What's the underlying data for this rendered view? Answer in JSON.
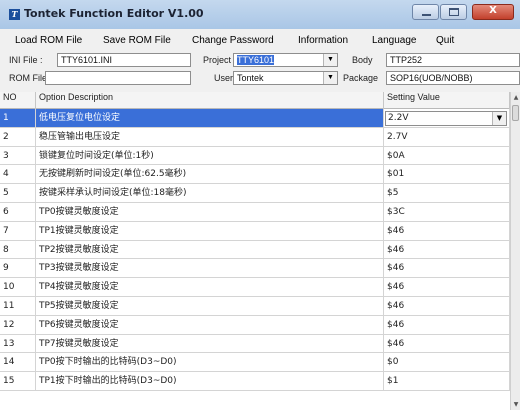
{
  "window": {
    "title": "Tontek Function Editor V1.00",
    "app_icon_glyph": "T",
    "close_glyph": "X"
  },
  "menu": [
    {
      "label": "Load ROM File"
    },
    {
      "label": "Save ROM File"
    },
    {
      "label": "Change Password"
    },
    {
      "label": "Information"
    },
    {
      "label": "Language"
    },
    {
      "label": "Quit"
    }
  ],
  "form": {
    "ini_file_label": "INI File :",
    "ini_file_value": "TTY6101.INI",
    "project_label": "Project",
    "project_value": "TTY6101",
    "body_label": "Body",
    "body_value": "TTP252",
    "rom_file_label": "ROM File",
    "rom_file_value": "",
    "user_label": "User",
    "user_value": "Tontek",
    "package_label": "Package",
    "package_value": "SOP16(UOB/NOBB)"
  },
  "grid": {
    "headers": {
      "no": "NO",
      "description": "Option Description",
      "value": "Setting Value"
    },
    "rows": [
      {
        "no": "1",
        "description": "低电压复位电位设定",
        "value": "2.2V",
        "selected": true
      },
      {
        "no": "2",
        "description": "稳压管输出电压设定",
        "value": "2.7V"
      },
      {
        "no": "3",
        "description": "锁键复位时间设定(单位:1秒)",
        "value": "$0A"
      },
      {
        "no": "4",
        "description": "无按键刷新时间设定(单位:62.5毫秒)",
        "value": "$01"
      },
      {
        "no": "5",
        "description": "按键采样承认时间设定(单位:18毫秒)",
        "value": "$5"
      },
      {
        "no": "6",
        "description": "TP0按键灵敏度设定",
        "value": "$3C"
      },
      {
        "no": "7",
        "description": "TP1按键灵敏度设定",
        "value": "$46"
      },
      {
        "no": "8",
        "description": "TP2按键灵敏度设定",
        "value": "$46"
      },
      {
        "no": "9",
        "description": "TP3按键灵敏度设定",
        "value": "$46"
      },
      {
        "no": "10",
        "description": "TP4按键灵敏度设定",
        "value": "$46"
      },
      {
        "no": "11",
        "description": "TP5按键灵敏度设定",
        "value": "$46"
      },
      {
        "no": "12",
        "description": "TP6按键灵敏度设定",
        "value": "$46"
      },
      {
        "no": "13",
        "description": "TP7按键灵敏度设定",
        "value": "$46"
      },
      {
        "no": "14",
        "description": "TP0按下时输出的比特码(D3~D0)",
        "value": "$0"
      },
      {
        "no": "15",
        "description": "TP1按下时输出的比特码(D3~D0)",
        "value": "$1"
      }
    ]
  },
  "icons": {
    "combo_arrow": "▼",
    "scroll_up": "▲",
    "scroll_down": "▼"
  },
  "colors": {
    "selection": "#3a6fd8",
    "titlebar": "#b4cde9",
    "close_button": "#c9493a"
  }
}
